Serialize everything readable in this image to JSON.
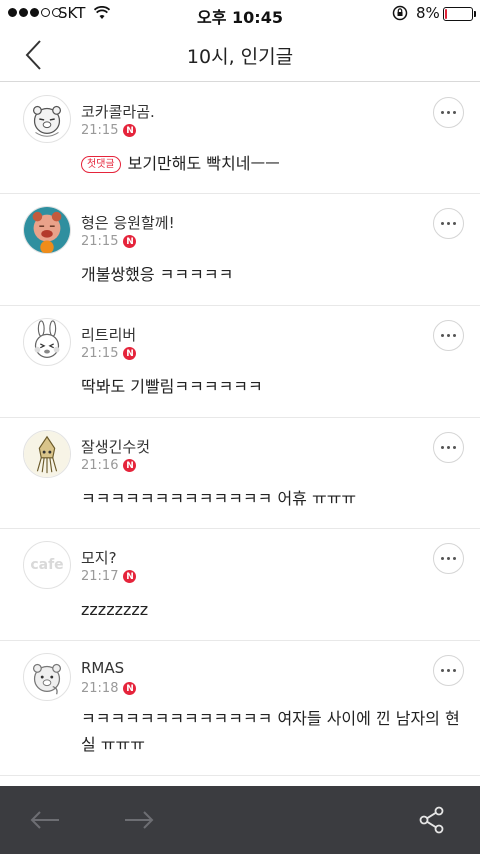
{
  "status_bar": {
    "carrier": "SKT",
    "time": "오후 10:45",
    "battery": "8%",
    "battery_level": 0.08,
    "battery_color": "#e0263a"
  },
  "header": {
    "title": "10시, 인기글"
  },
  "comments": [
    {
      "author": "코카콜라곰.",
      "time": "21:15",
      "new_badge": "N",
      "first_badge": "첫댓글",
      "text": "보기만해도 빡치네ㅡㅡ",
      "avatar_icon": "bear-character-icon"
    },
    {
      "author": "형은 응원할께!",
      "time": "21:15",
      "new_badge": "N",
      "text": "개불쌍했응 ㅋㅋㅋㅋㅋ",
      "avatar_icon": "orange-cartoon-character-icon"
    },
    {
      "author": "리트리버",
      "time": "21:15",
      "new_badge": "N",
      "text": "딱봐도 기빨림ㅋㅋㅋㅋㅋㅋ",
      "avatar_icon": "rabbit-character-icon"
    },
    {
      "author": "잘생긴수컷",
      "time": "21:16",
      "new_badge": "N",
      "text": "ㅋㅋㅋㅋㅋㅋㅋㅋㅋㅋㅋㅋㅋ 어휴 ㅠㅠㅠ",
      "avatar_icon": "squid-character-icon"
    },
    {
      "author": "모지?",
      "time": "21:17",
      "new_badge": "N",
      "text": "zzzzzzzz",
      "avatar_icon": "cafe-default-avatar",
      "avatar_text": "cafe"
    },
    {
      "author": "RMAS",
      "time": "21:18",
      "new_badge": "N",
      "text": "ㅋㅋㅋㅋㅋㅋㅋㅋㅋㅋㅋㅋㅋ 여자들 사이에 낀 남자의 현실 ㅠㅠㅠ",
      "avatar_icon": "bear-character-icon"
    }
  ],
  "bottom_bar": {
    "icons": [
      "arrow-left-icon",
      "arrow-right-icon",
      "share-icon"
    ]
  }
}
